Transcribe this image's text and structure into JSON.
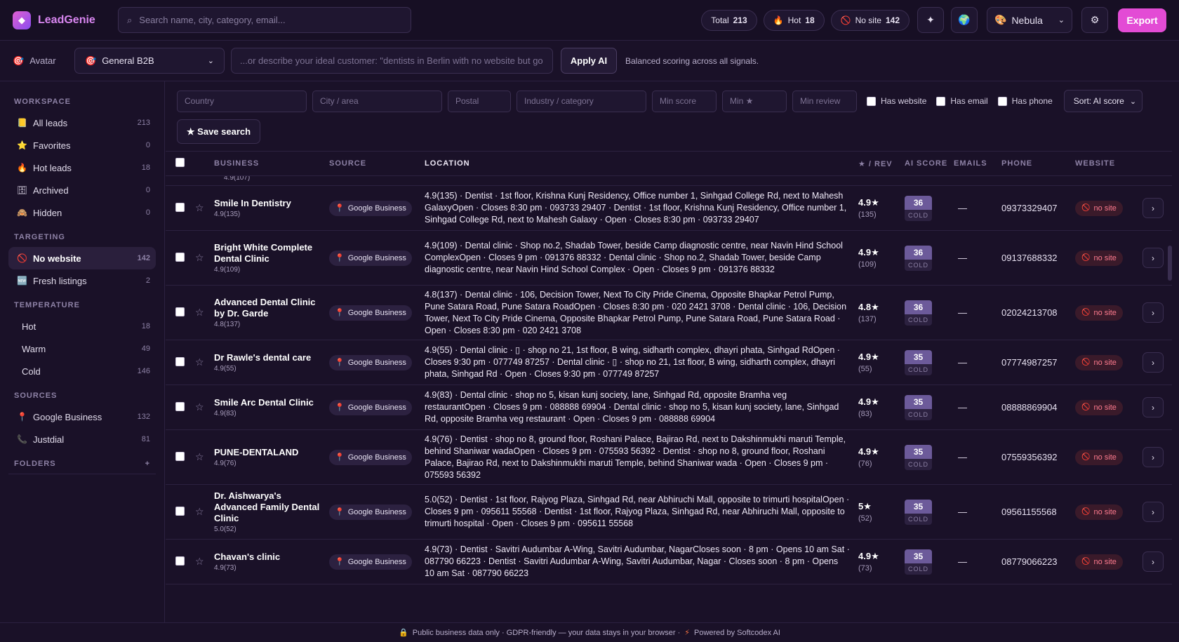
{
  "app": {
    "name": "LeadGenie"
  },
  "topbar": {
    "search_placeholder": "Search name, city, category, email...",
    "stats": [
      {
        "label": "Total",
        "value": "213",
        "icon": "none"
      },
      {
        "label": "Hot",
        "value": "18",
        "icon": "fire-icon"
      },
      {
        "label": "No site",
        "value": "142",
        "icon": "no-entry-icon"
      }
    ],
    "theme": "Nebula",
    "export_label": "Export"
  },
  "avatar_bar": {
    "label": "Avatar",
    "selected": "General B2B",
    "describe_placeholder": "...or describe your ideal customer: \"dentists in Berlin with no website but go",
    "apply_label": "Apply AI",
    "hint": "Balanced scoring across all signals."
  },
  "sidebar": {
    "workspace_head": "WORKSPACE",
    "workspace": [
      {
        "label": "All leads",
        "count": "213",
        "icon": "📒"
      },
      {
        "label": "Favorites",
        "count": "0",
        "icon": "⭐"
      },
      {
        "label": "Hot leads",
        "count": "18",
        "icon": "🔥"
      },
      {
        "label": "Archived",
        "count": "0",
        "icon": "🗄"
      },
      {
        "label": "Hidden",
        "count": "0",
        "icon": "🙈"
      }
    ],
    "targeting_head": "TARGETING",
    "targeting": [
      {
        "label": "No website",
        "count": "142",
        "icon": "🚫"
      },
      {
        "label": "Fresh listings",
        "count": "2",
        "icon": "🆕"
      }
    ],
    "temperature_head": "TEMPERATURE",
    "temperature": [
      {
        "label": "Hot",
        "count": "18"
      },
      {
        "label": "Warm",
        "count": "49"
      },
      {
        "label": "Cold",
        "count": "146"
      }
    ],
    "sources_head": "SOURCES",
    "sources": [
      {
        "label": "Google Business",
        "count": "132",
        "icon": "📍"
      },
      {
        "label": "Justdial",
        "count": "81",
        "icon": "📞"
      }
    ],
    "folders_head": "FOLDERS",
    "folders_add": "+"
  },
  "filters": {
    "country": "Country",
    "city": "City / area",
    "postal": "Postal",
    "industry": "Industry / category",
    "min_score": "Min score",
    "min_star": "Min ★",
    "min_review": "Min review",
    "has_website": "Has website",
    "has_email": "Has email",
    "has_phone": "Has phone",
    "sort": "Sort: AI score",
    "save_search": "★ Save search"
  },
  "table": {
    "headers": {
      "business": "BUSINESS",
      "source": "SOURCE",
      "location": "LOCATION",
      "rev": "★ / REV",
      "score": "AI SCORE",
      "emails": "EMAILS",
      "phone": "PHONE",
      "website": "WEBSITE"
    },
    "partial_row_sub": "4.9(107)",
    "rows": [
      {
        "name": "Smile In Dentistry",
        "sub": "4.9(135)",
        "source": "Google Business",
        "location": "4.9(135) · Dentist · 1st floor, Krishna Kunj Residency, Office number 1, Sinhgad College Rd, next to Mahesh GalaxyOpen · Closes 8:30 pm · 093733 29407 · Dentist · 1st floor, Krishna Kunj Residency, Office number 1, Sinhgad College Rd, next to Mahesh Galaxy · Open · Closes 8:30 pm · 093733 29407",
        "rating": "4.9★",
        "reviews": "(135)",
        "score": "36",
        "temp": "COLD",
        "emails": "—",
        "phone": "09373329407",
        "website": "no site"
      },
      {
        "name": "Bright White Complete Dental Clinic",
        "sub": "4.9(109)",
        "source": "Google Business",
        "location": "4.9(109) · Dental clinic · Shop no.2, Shadab Tower, beside Camp diagnostic centre, near Navin Hind School ComplexOpen · Closes 9 pm · 091376 88332 · Dental clinic · Shop no.2, Shadab Tower, beside Camp diagnostic centre, near Navin Hind School Complex · Open · Closes 9 pm · 091376 88332",
        "rating": "4.9★",
        "reviews": "(109)",
        "score": "36",
        "temp": "COLD",
        "emails": "—",
        "phone": "09137688332",
        "website": "no site"
      },
      {
        "name": "Advanced Dental Clinic by Dr. Garde",
        "sub": "4.8(137)",
        "source": "Google Business",
        "location": "4.8(137) · Dental clinic · 106, Decision Tower, Next To City Pride Cinema, Opposite Bhapkar Petrol Pump, Pune Satara Road, Pune Satara RoadOpen · Closes 8:30 pm · 020 2421 3708 · Dental clinic · 106, Decision Tower, Next To City Pride Cinema, Opposite Bhapkar Petrol Pump, Pune Satara Road, Pune Satara Road · Open · Closes 8:30 pm · 020 2421 3708",
        "rating": "4.8★",
        "reviews": "(137)",
        "score": "36",
        "temp": "COLD",
        "emails": "—",
        "phone": "02024213708",
        "website": "no site"
      },
      {
        "name": "Dr Rawle's dental care",
        "sub": "4.9(55)",
        "source": "Google Business",
        "location": "4.9(55) · Dental clinic · ▯ · shop no 21, 1st floor, B wing, sidharth complex, dhayri phata, Sinhgad RdOpen · Closes 9:30 pm · 077749 87257 · Dental clinic · ▯ · shop no 21, 1st floor, B wing, sidharth complex, dhayri phata, Sinhgad Rd · Open · Closes 9:30 pm · 077749 87257",
        "rating": "4.9★",
        "reviews": "(55)",
        "score": "35",
        "temp": "COLD",
        "emails": "—",
        "phone": "07774987257",
        "website": "no site"
      },
      {
        "name": "Smile Arc Dental Clinic",
        "sub": "4.9(83)",
        "source": "Google Business",
        "location": "4.9(83) · Dental clinic · shop no 5, kisan kunj society, lane, Sinhgad Rd, opposite Bramha veg restaurantOpen · Closes 9 pm · 088888 69904 · Dental clinic · shop no 5, kisan kunj society, lane, Sinhgad Rd, opposite Bramha veg restaurant · Open · Closes 9 pm · 088888 69904",
        "rating": "4.9★",
        "reviews": "(83)",
        "score": "35",
        "temp": "COLD",
        "emails": "—",
        "phone": "08888869904",
        "website": "no site"
      },
      {
        "name": "PUNE-DENTALAND",
        "sub": "4.9(76)",
        "source": "Google Business",
        "location": "4.9(76) · Dentist · shop no 8, ground floor, Roshani Palace, Bajirao Rd, next to Dakshinmukhi maruti Temple, behind Shaniwar wadaOpen · Closes 9 pm · 075593 56392 · Dentist · shop no 8, ground floor, Roshani Palace, Bajirao Rd, next to Dakshinmukhi maruti Temple, behind Shaniwar wada · Open · Closes 9 pm · 075593 56392",
        "rating": "4.9★",
        "reviews": "(76)",
        "score": "35",
        "temp": "COLD",
        "emails": "—",
        "phone": "07559356392",
        "website": "no site"
      },
      {
        "name": "Dr. Aishwarya's Advanced Family Dental Clinic",
        "sub": "5.0(52)",
        "source": "Google Business",
        "location": "5.0(52) · Dentist · 1st floor, Rajyog Plaza, Sinhgad Rd, near Abhiruchi Mall, opposite to trimurti hospitalOpen · Closes 9 pm · 095611 55568 · Dentist · 1st floor, Rajyog Plaza, Sinhgad Rd, near Abhiruchi Mall, opposite to trimurti hospital · Open · Closes 9 pm · 095611 55568",
        "rating": "5★",
        "reviews": "(52)",
        "score": "35",
        "temp": "COLD",
        "emails": "—",
        "phone": "09561155568",
        "website": "no site"
      },
      {
        "name": "Chavan's clinic",
        "sub": "4.9(73)",
        "source": "Google Business",
        "location": "4.9(73) · Dentist · Savitri Audumbar A-Wing, Savitri Audumbar, NagarCloses soon · 8 pm · Opens 10 am Sat · 087790 66223 · Dentist · Savitri Audumbar A-Wing, Savitri Audumbar, Nagar · Closes soon · 8 pm · Opens 10 am Sat · 087790 66223",
        "rating": "4.9★",
        "reviews": "(73)",
        "score": "35",
        "temp": "COLD",
        "emails": "—",
        "phone": "08779066223",
        "website": "no site"
      }
    ]
  },
  "footer": {
    "text": "Public business data only · GDPR-friendly — your data stays in your browser ·",
    "powered": "Powered by Softcodex AI"
  }
}
